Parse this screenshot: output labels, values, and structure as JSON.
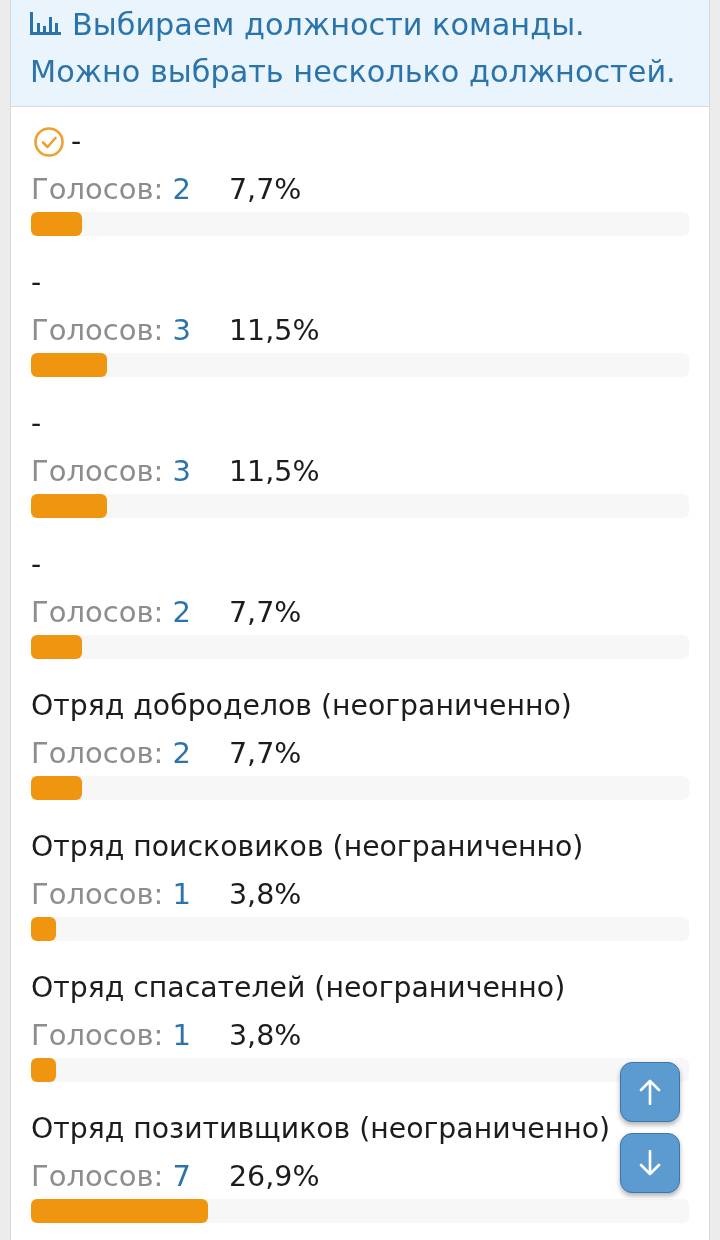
{
  "poll": {
    "title_lines": [
      "Выбираем должности команды.",
      "Можно выбрать несколько должностей."
    ],
    "options": [
      {
        "label": "-",
        "voted": true,
        "votes_caption": "Голосов:",
        "votes": "2",
        "percent": "7,7%",
        "level": 0.077
      },
      {
        "label": "-",
        "voted": false,
        "votes_caption": "Голосов:",
        "votes": "3",
        "percent": "11,5%",
        "level": 0.115
      },
      {
        "label": "-",
        "voted": false,
        "votes_caption": "Голосов:",
        "votes": "3",
        "percent": "11,5%",
        "level": 0.115
      },
      {
        "label": "-",
        "voted": false,
        "votes_caption": "Голосов:",
        "votes": "2",
        "percent": "7,7%",
        "level": 0.077
      },
      {
        "label": "Отряд доброделов (неограниченно)",
        "voted": false,
        "votes_caption": "Голосов:",
        "votes": "2",
        "percent": "7,7%",
        "level": 0.077
      },
      {
        "label": "Отряд поисковиков (неограниченно)",
        "voted": false,
        "votes_caption": "Голосов:",
        "votes": "1",
        "percent": "3,8%",
        "level": 0.038
      },
      {
        "label": "Отряд спасателей (неограниченно)",
        "voted": false,
        "votes_caption": "Голосов:",
        "votes": "1",
        "percent": "3,8%",
        "level": 0.038
      },
      {
        "label": "Отряд позитивщиков (неограниченно)",
        "voted": false,
        "votes_caption": "Голосов:",
        "votes": "7",
        "percent": "26,9%",
        "level": 0.269
      }
    ]
  }
}
